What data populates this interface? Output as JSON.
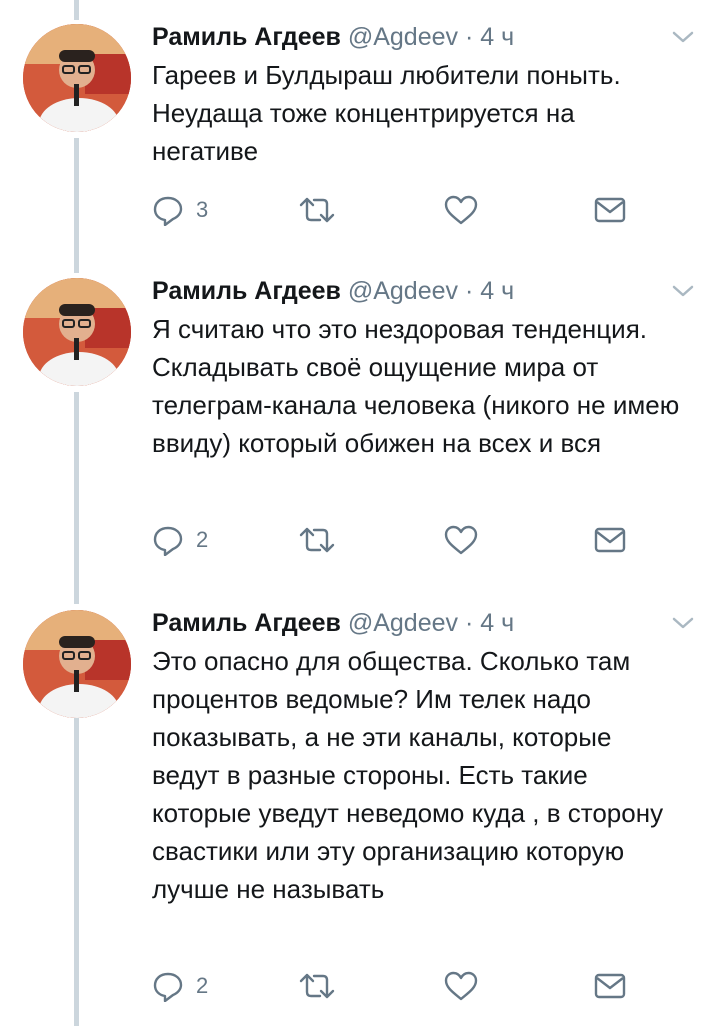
{
  "tweets": [
    {
      "author_name": "Рамиль Агдеев",
      "handle": "@Agdeev",
      "separator": "·",
      "time": "4 ч",
      "text": "Гареев и Булдыраш любители поныть. Неудаща тоже концентрируется на негативе",
      "reply_count": "3",
      "retweet_count": "",
      "like_count": ""
    },
    {
      "author_name": "Рамиль Агдеев",
      "handle": "@Agdeev",
      "separator": "·",
      "time": "4 ч",
      "text": "Я считаю что это нездоровая тенденция. Складывать своё ощущение мира от телеграм-канала человека (никого не имею ввиду) который обижен на всех и вся",
      "reply_count": "2",
      "retweet_count": "",
      "like_count": ""
    },
    {
      "author_name": "Рамиль Агдеев",
      "handle": "@Agdeev",
      "separator": "·",
      "time": "4 ч",
      "text": "Это опасно для общества. Сколько там процентов ведомые? Им телек надо показывать, а не эти каналы, которые ведут в разные стороны. Есть такие которые уведут неведомо куда , в сторону свастики или эту организацию которую лучше не называть",
      "reply_count": "2",
      "retweet_count": "",
      "like_count": ""
    }
  ],
  "icons": {
    "reply": "reply-icon",
    "retweet": "retweet-icon",
    "like": "heart-icon",
    "dm": "envelope-icon",
    "more": "chevron-down-icon"
  },
  "colors": {
    "text": "#14171a",
    "secondary": "#657786",
    "thread_line": "#ccd6dd"
  }
}
